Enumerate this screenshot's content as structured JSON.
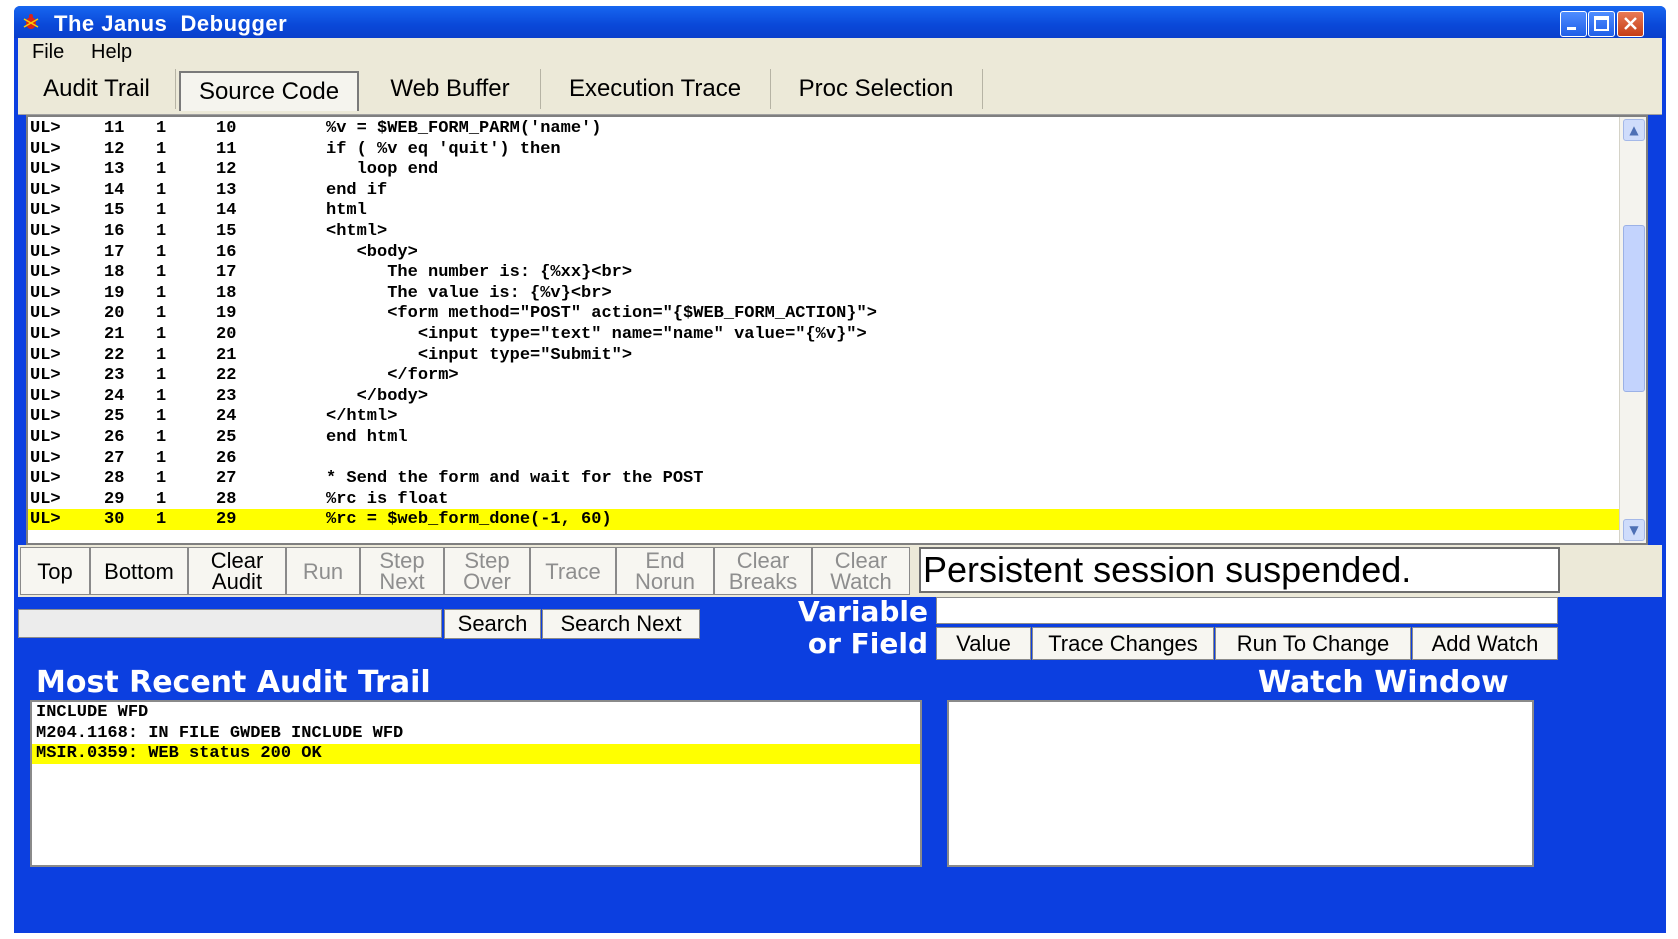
{
  "window": {
    "title": "The Janus  Debugger",
    "icons": {
      "app": "bug-app-icon",
      "minimize": "minimize-icon",
      "maximize": "maximize-icon",
      "close": "close-icon"
    },
    "colors": {
      "frame": "#0c3fe0",
      "titlebar": "#0a48d8",
      "highlight": "#ffff00",
      "chrome": "#ece9d8"
    }
  },
  "menu": [
    "File",
    "Help"
  ],
  "tabs": [
    {
      "label": "Audit Trail",
      "active": false
    },
    {
      "label": "Source Code",
      "active": true
    },
    {
      "label": "Web Buffer",
      "active": false
    },
    {
      "label": "Execution Trace",
      "active": false
    },
    {
      "label": "Proc Selection",
      "active": false
    }
  ],
  "source": {
    "highlighted_line": 30,
    "rows": [
      {
        "prefix": "UL>",
        "line": "11",
        "level": "1",
        "stmt": "10",
        "code": "%v = $WEB_FORM_PARM('name')"
      },
      {
        "prefix": "UL>",
        "line": "12",
        "level": "1",
        "stmt": "11",
        "code": "if ( %v eq 'quit') then"
      },
      {
        "prefix": "UL>",
        "line": "13",
        "level": "1",
        "stmt": "12",
        "code": "   loop end"
      },
      {
        "prefix": "UL>",
        "line": "14",
        "level": "1",
        "stmt": "13",
        "code": "end if"
      },
      {
        "prefix": "UL>",
        "line": "15",
        "level": "1",
        "stmt": "14",
        "code": "html"
      },
      {
        "prefix": "UL>",
        "line": "16",
        "level": "1",
        "stmt": "15",
        "code": "<html>"
      },
      {
        "prefix": "UL>",
        "line": "17",
        "level": "1",
        "stmt": "16",
        "code": "   <body>"
      },
      {
        "prefix": "UL>",
        "line": "18",
        "level": "1",
        "stmt": "17",
        "code": "      The number is: {%xx}<br>"
      },
      {
        "prefix": "UL>",
        "line": "19",
        "level": "1",
        "stmt": "18",
        "code": "      The value is: {%v}<br>"
      },
      {
        "prefix": "UL>",
        "line": "20",
        "level": "1",
        "stmt": "19",
        "code": "      <form method=\"POST\" action=\"{$WEB_FORM_ACTION}\">"
      },
      {
        "prefix": "UL>",
        "line": "21",
        "level": "1",
        "stmt": "20",
        "code": "         <input type=\"text\" name=\"name\" value=\"{%v}\">"
      },
      {
        "prefix": "UL>",
        "line": "22",
        "level": "1",
        "stmt": "21",
        "code": "         <input type=\"Submit\">"
      },
      {
        "prefix": "UL>",
        "line": "23",
        "level": "1",
        "stmt": "22",
        "code": "      </form>"
      },
      {
        "prefix": "UL>",
        "line": "24",
        "level": "1",
        "stmt": "23",
        "code": "   </body>"
      },
      {
        "prefix": "UL>",
        "line": "25",
        "level": "1",
        "stmt": "24",
        "code": "</html>"
      },
      {
        "prefix": "UL>",
        "line": "26",
        "level": "1",
        "stmt": "25",
        "code": "end html"
      },
      {
        "prefix": "UL>",
        "line": "27",
        "level": "1",
        "stmt": "26",
        "code": ""
      },
      {
        "prefix": "UL>",
        "line": "28",
        "level": "1",
        "stmt": "27",
        "code": "* Send the form and wait for the POST"
      },
      {
        "prefix": "UL>",
        "line": "29",
        "level": "1",
        "stmt": "28",
        "code": "%rc is float"
      },
      {
        "prefix": "UL>",
        "line": "30",
        "level": "1",
        "stmt": "29",
        "code": "%rc = $web_form_done(-1, 60)"
      }
    ]
  },
  "toolbar": {
    "buttons": [
      {
        "label": "Top",
        "enabled": true
      },
      {
        "label": "Bottom",
        "enabled": true
      },
      {
        "label": "Clear\nAudit",
        "enabled": true
      },
      {
        "label": "Run",
        "enabled": false
      },
      {
        "label": "Step\nNext",
        "enabled": false
      },
      {
        "label": "Step\nOver",
        "enabled": false
      },
      {
        "label": "Trace",
        "enabled": false
      },
      {
        "label": "End\nNorun",
        "enabled": false
      },
      {
        "label": "Clear\nBreaks",
        "enabled": false
      },
      {
        "label": "Clear\nWatch",
        "enabled": false
      }
    ],
    "status": "Persistent session suspended."
  },
  "search": {
    "value": "",
    "search_label": "Search",
    "search_next_label": "Search Next"
  },
  "variable": {
    "label": "Variable\nor Field",
    "value": "",
    "buttons": [
      "Value",
      "Trace Changes",
      "Run To Change",
      "Add Watch"
    ]
  },
  "audit": {
    "heading": "Most Recent Audit Trail",
    "rows": [
      {
        "text": "INCLUDE WFD",
        "highlight": false
      },
      {
        "text": "M204.1168: IN FILE GWDEB INCLUDE WFD",
        "highlight": false
      },
      {
        "text": "MSIR.0359: WEB status 200 OK",
        "highlight": true
      }
    ]
  },
  "watch": {
    "heading": "Watch Window"
  }
}
